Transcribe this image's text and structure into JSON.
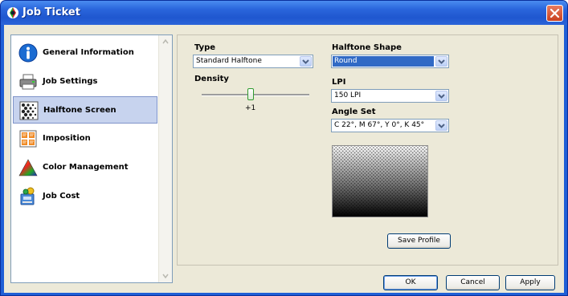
{
  "window": {
    "title": "Job Ticket"
  },
  "nav": {
    "items": [
      {
        "label": "General Information",
        "icon": "info-icon"
      },
      {
        "label": "Job Settings",
        "icon": "printer-icon"
      },
      {
        "label": "Halftone Screen",
        "icon": "halftone-icon",
        "selected": true
      },
      {
        "label": "Imposition",
        "icon": "imposition-icon"
      },
      {
        "label": "Color Management",
        "icon": "color-triangle-icon"
      },
      {
        "label": "Job Cost",
        "icon": "cost-icon"
      }
    ]
  },
  "halftone": {
    "type_label": "Type",
    "type_value": "Standard Halftone",
    "density_label": "Density",
    "density_value": "+1",
    "shape_label": "Halftone Shape",
    "shape_value": "Round",
    "lpi_label": "LPI",
    "lpi_value": "150 LPI",
    "angle_label": "Angle Set",
    "angle_value": "C 22°, M 67°, Y 0°, K 45°",
    "save_profile_label": "Save Profile"
  },
  "footer": {
    "ok_label": "OK",
    "cancel_label": "Cancel",
    "apply_label": "Apply"
  },
  "colors": {
    "titlebar": "#2a66dc",
    "selection": "#316ac5",
    "dialog_bg": "#ece9d8"
  }
}
